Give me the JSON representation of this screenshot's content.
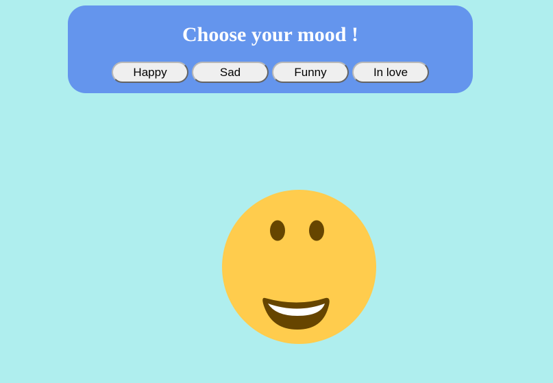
{
  "header": {
    "title": "Choose your mood !"
  },
  "buttons": [
    {
      "label": "Happy"
    },
    {
      "label": "Sad"
    },
    {
      "label": "Funny"
    },
    {
      "label": "In love"
    }
  ],
  "emoji": {
    "mood": "happy",
    "icon": "smiling-face-icon",
    "colors": {
      "face": "#ffcc4d",
      "features": "#664500",
      "teeth": "#ffffff"
    }
  },
  "colors": {
    "background": "#afeeee",
    "panel": "#6495ed",
    "title": "#ffffff",
    "button": "#efefef"
  }
}
